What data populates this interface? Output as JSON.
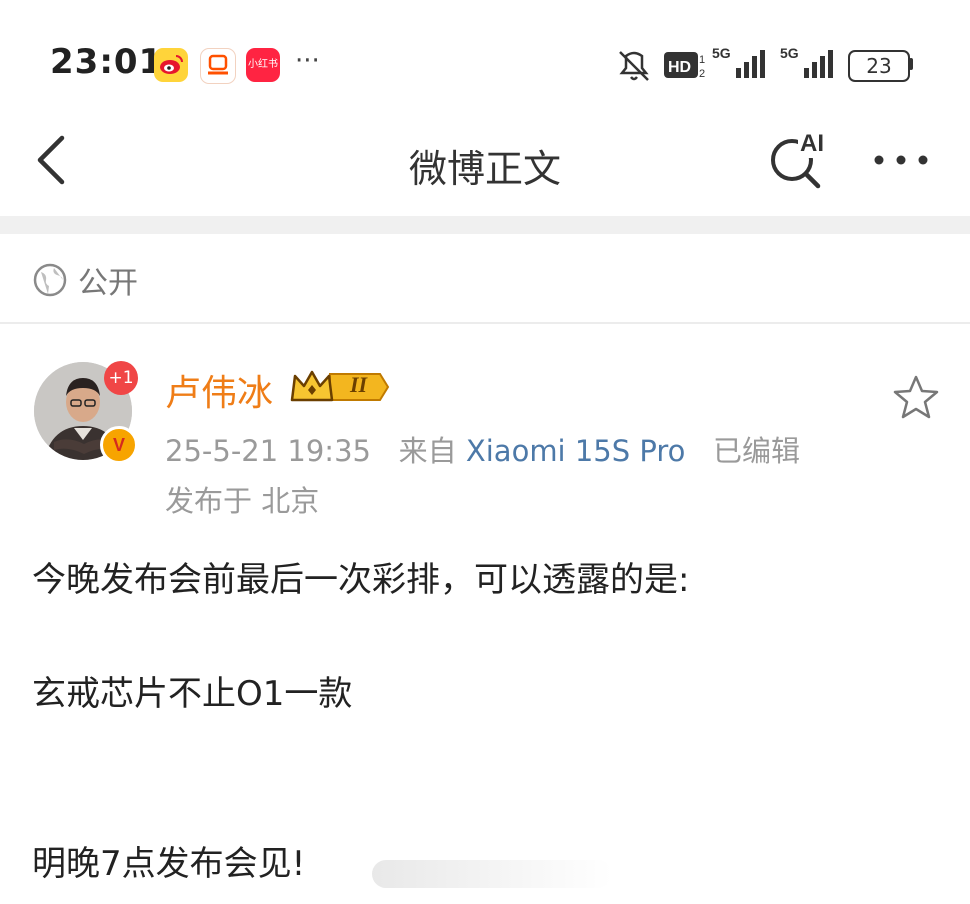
{
  "status_bar": {
    "time": "23:01",
    "more": "···",
    "battery": "23",
    "icons": [
      "weibo-app-icon",
      "taobao-app-icon",
      "xiaohongshu-app-icon",
      "mute-icon",
      "hd-icon",
      "signal-5g-icon",
      "signal-5g-icon",
      "battery-icon"
    ],
    "xiaohongshu_label": "小红书"
  },
  "nav": {
    "title": "微博正文",
    "ai_label": "AI"
  },
  "post": {
    "visibility": "公开",
    "author": "卢伟冰",
    "level_badge": "II",
    "plus_badge": "+1",
    "verified_badge": "V",
    "timestamp": "25-5-21 19:35",
    "source_prefix": "来自",
    "source": "Xiaomi 15S Pro",
    "edited": "已编辑",
    "location": "发布于 北京",
    "lines": [
      "今晚发布会前最后一次彩排，可以透露的是:",
      "玄戒芯片不止O1一款",
      "明晚7点发布会见!"
    ]
  },
  "colors": {
    "author": "#ef7d17",
    "source_link": "#4d79a8",
    "meta": "#9a9a9a",
    "badge_red": "#f04646",
    "verified": "#f7a400",
    "divider": "#f0f0f0"
  }
}
